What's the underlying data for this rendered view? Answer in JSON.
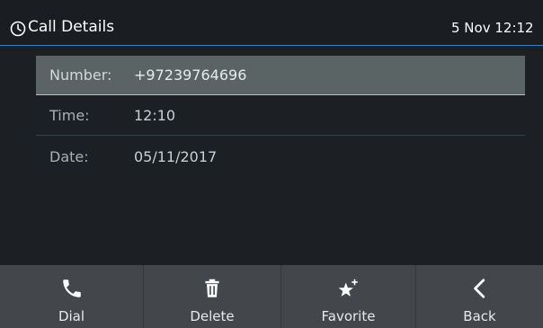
{
  "header": {
    "title": "Call Details",
    "datetime": "5 Nov 12:12"
  },
  "details": [
    {
      "label": "Number:",
      "value": "+97239764696"
    },
    {
      "label": "Time:",
      "value": "12:10"
    },
    {
      "label": "Date:",
      "value": "05/11/2017"
    }
  ],
  "softkeys": [
    {
      "label": "Dial",
      "icon": "phone-icon"
    },
    {
      "label": "Delete",
      "icon": "trash-icon"
    },
    {
      "label": "Favorite",
      "icon": "star-plus-icon"
    },
    {
      "label": "Back",
      "icon": "chevron-left-icon"
    }
  ],
  "colors": {
    "accent": "#2f84c4",
    "background": "#1c2025",
    "selected_row": "#5a6464",
    "softkey_bar": "#43474b"
  }
}
